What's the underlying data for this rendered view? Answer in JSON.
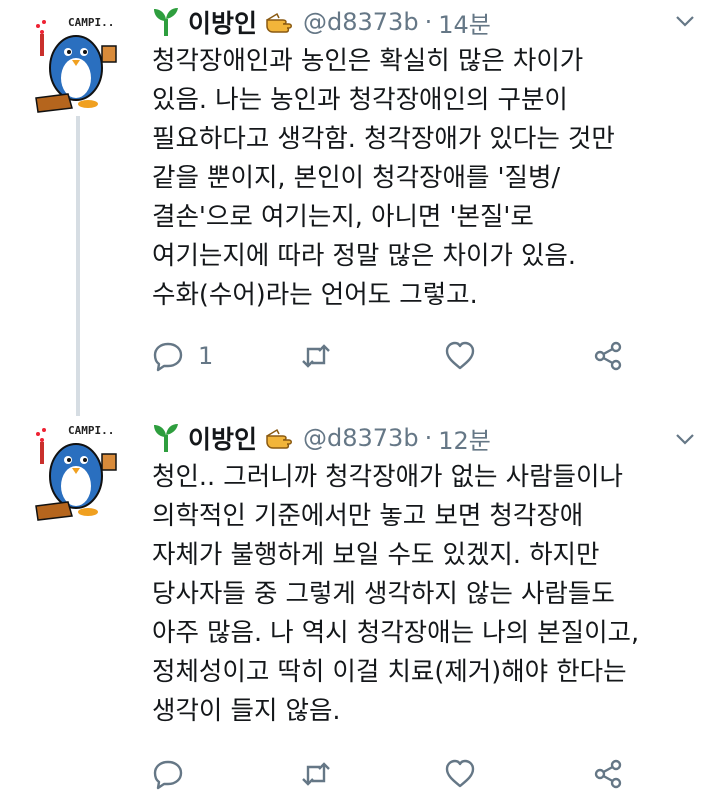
{
  "tweets": [
    {
      "author": {
        "name": "이방인",
        "handle": "@d8373b",
        "separator": "·",
        "time": "14분",
        "avatar_text": "CAMPI.."
      },
      "lines": [
        "청각장애인과 농인은 확실히 많은 차이가",
        "있음. 나는 농인과 청각장애인의 구분이",
        "필요하다고 생각함. 청각장애가 있다는 것만",
        "같을 뿐이지, 본인이 청각장애를 '질병/",
        "결손'으로 여기는지, 아니면 '본질'로",
        "여기는지에 따라 정말 많은 차이가 있음.",
        "수화(수어)라는 언어도 그렇고."
      ],
      "counts": {
        "reply": "1",
        "retweet": "",
        "like": ""
      }
    },
    {
      "author": {
        "name": "이방인",
        "handle": "@d8373b",
        "separator": "·",
        "time": "12분",
        "avatar_text": "CAMPI.."
      },
      "lines": [
        "청인.. 그러니까 청각장애가 없는 사람들이나",
        "의학적인 기준에서만 놓고 보면 청각장애",
        "자체가 불행하게 보일 수도 있겠지. 하지만",
        "당사자들 중 그렇게 생각하지 않는 사람들도",
        "아주 많음. 나 역시 청각장애는 나의 본질이고,",
        "정체성이고 딱히 이걸 치료(제거)해야 한다는",
        "생각이 들지 않음."
      ],
      "counts": {
        "reply": "",
        "retweet": "",
        "like": ""
      }
    }
  ],
  "colors": {
    "text": "#14171a",
    "secondary": "#657786",
    "thread": "#d6dde3",
    "sprout": "#2e9e3e",
    "penguin": "#2a6fbf"
  },
  "icons": [
    "sprout-icon",
    "pointing-hand-icon",
    "chevron-down-icon",
    "reply-icon",
    "retweet-icon",
    "like-icon",
    "share-icon"
  ]
}
